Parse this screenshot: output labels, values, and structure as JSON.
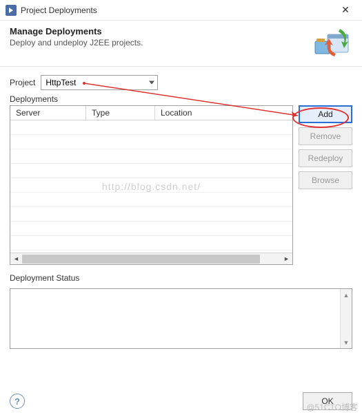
{
  "window": {
    "title": "Project Deployments",
    "close_icon": "✕"
  },
  "header": {
    "title": "Manage Deployments",
    "subtitle": "Deploy and undeploy J2EE projects."
  },
  "project": {
    "label": "Project",
    "selected": "HttpTest"
  },
  "deployments": {
    "label": "Deployments",
    "columns": {
      "server": "Server",
      "type": "Type",
      "location": "Location"
    },
    "rows": [],
    "watermark": "http://blog.csdn.net/"
  },
  "buttons": {
    "add": "Add",
    "remove": "Remove",
    "redeploy": "Redeploy",
    "browse": "Browse"
  },
  "status": {
    "label": "Deployment Status"
  },
  "footer": {
    "help": "?",
    "ok": "OK"
  },
  "corner_wm": "@51CTO博客"
}
